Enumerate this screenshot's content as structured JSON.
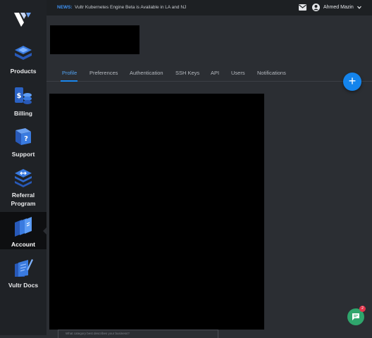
{
  "sidebar": {
    "items": [
      {
        "label": "Products",
        "icon": "products-stack-icon"
      },
      {
        "label": "Billing",
        "icon": "billing-coins-icon"
      },
      {
        "label": "Support",
        "icon": "support-cube-icon"
      },
      {
        "label_line1": "Referral",
        "label_line2": "Program",
        "icon": "referral-layers-icon"
      },
      {
        "label": "Account",
        "icon": "account-cards-icon",
        "active": true
      },
      {
        "label": "Vultr Docs",
        "icon": "docs-pencil-icon"
      }
    ]
  },
  "topbar": {
    "news_tag": "NEWS:",
    "news_text": "Vultr Kubernetes Engine Beta is Available in LA and NJ",
    "user_name": "Ahmed Mazin"
  },
  "tabs": [
    {
      "label": "Profile",
      "active": true
    },
    {
      "label": "Preferences"
    },
    {
      "label": "Authentication"
    },
    {
      "label": "SSH Keys"
    },
    {
      "label": "API"
    },
    {
      "label": "Users"
    },
    {
      "label": "Notifications"
    }
  ],
  "fab": {
    "label": "+"
  },
  "form": {
    "hint": "What category best describes your business?"
  },
  "chat": {
    "badge": "2"
  },
  "colors": {
    "accent": "#1484ec",
    "sidebar_bg": "#1f2226",
    "page_bg": "#2b2e33",
    "chat": "#2fa56c",
    "badge": "#e2334a"
  }
}
